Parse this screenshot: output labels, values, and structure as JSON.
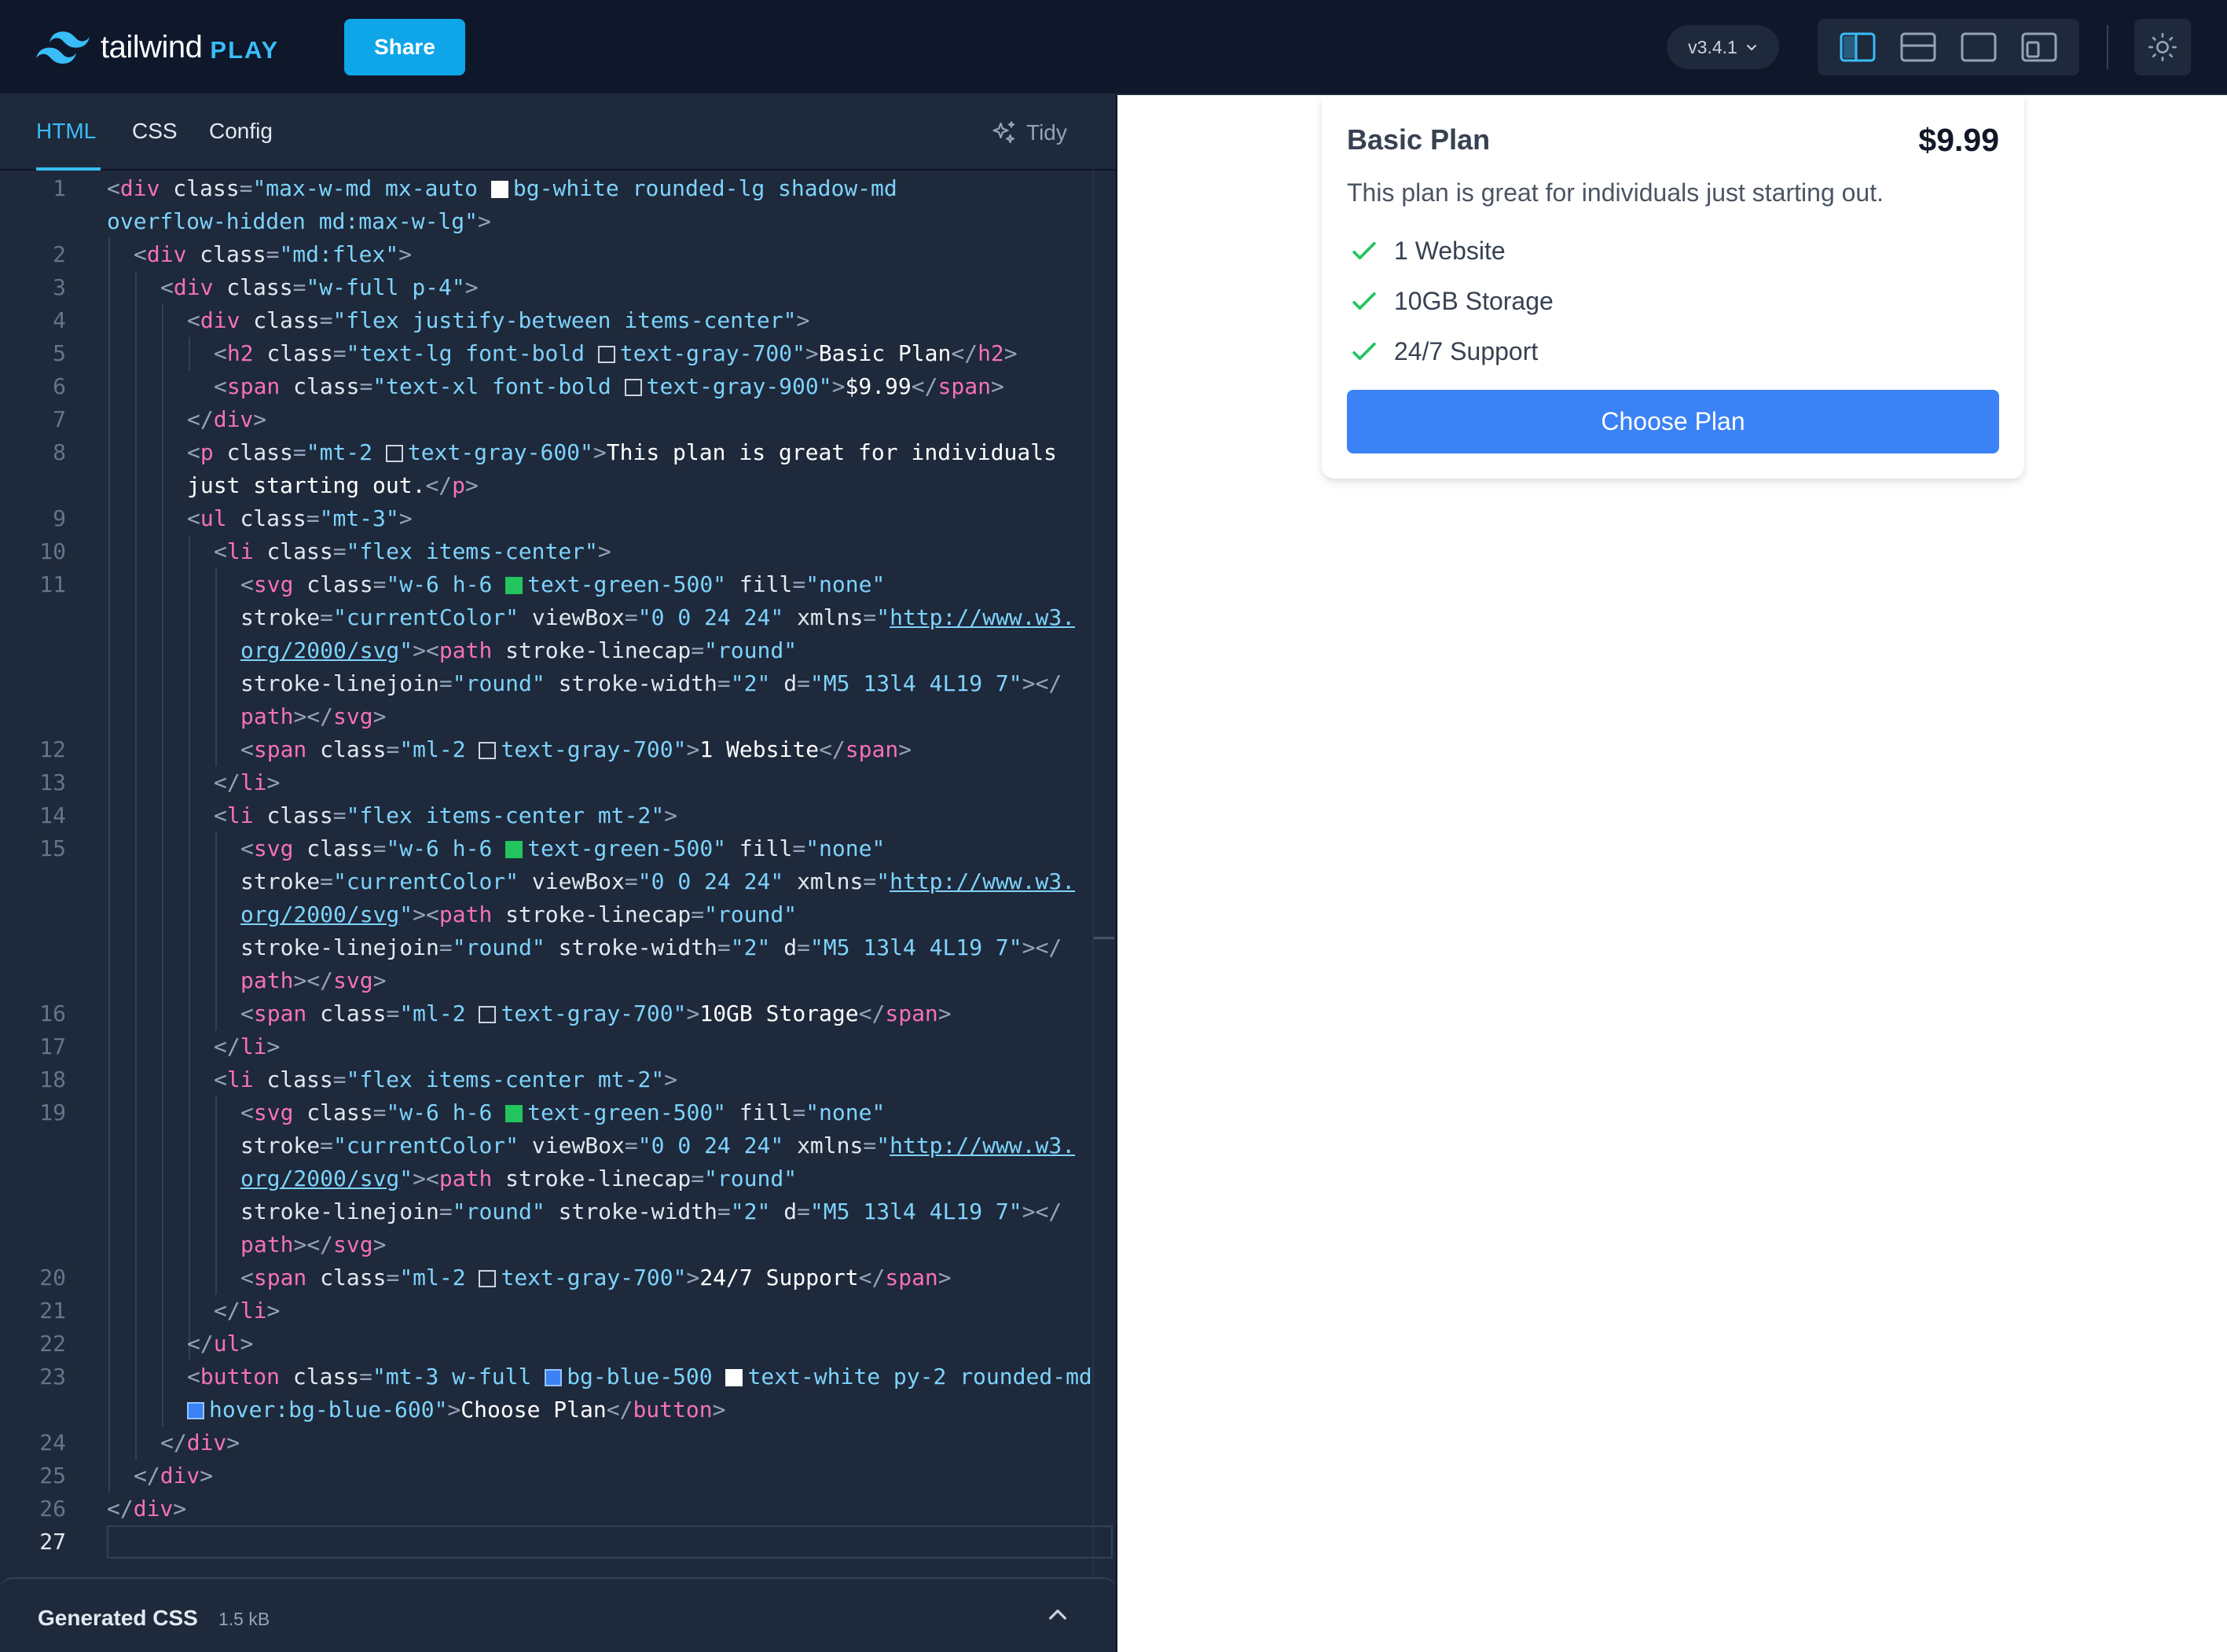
{
  "header": {
    "logo_word": "tailwind",
    "logo_play": "PLAY",
    "share_label": "Share",
    "version_label": "v3.4.1",
    "layout_icons": [
      "layout-split-vertical-icon",
      "layout-split-horizontal-icon",
      "layout-preview-only-icon",
      "layout-responsive-icon"
    ],
    "theme_icon": "sun-icon"
  },
  "editor": {
    "tabs": [
      {
        "label": "HTML",
        "active": true
      },
      {
        "label": "CSS",
        "active": false
      },
      {
        "label": "Config",
        "active": false
      }
    ],
    "tidy_label": "Tidy",
    "line_numbers": [
      "1",
      "2",
      "3",
      "4",
      "5",
      "6",
      "7",
      "8",
      "9",
      "10",
      "11",
      "12",
      "13",
      "14",
      "15",
      "16",
      "17",
      "18",
      "19",
      "20",
      "21",
      "22",
      "23",
      "24",
      "25",
      "26",
      "27"
    ],
    "active_line": "27"
  },
  "generated_css": {
    "title": "Generated CSS",
    "size": "1.5 kB"
  },
  "preview": {
    "plan_name": "Basic Plan",
    "price": "$9.99",
    "description": "This plan is great for individuals just starting out.",
    "features": [
      "1 Website",
      "10GB Storage",
      "24/7 Support"
    ],
    "button_label": "Choose Plan"
  },
  "colors": {
    "header_bg": "#0f172a",
    "editor_bg": "#1e293b",
    "accent": "#38bdf8",
    "share": "#0ea5e9",
    "check_green": "#22c55e",
    "button_blue": "#3b82f6"
  }
}
